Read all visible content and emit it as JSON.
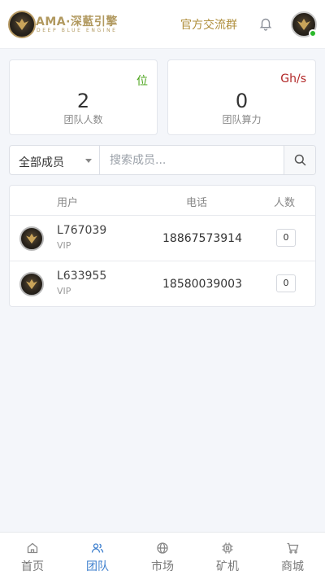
{
  "header": {
    "logo": {
      "title": "AMA·深藍引擎",
      "subtitle": "DEEP BLUE ENGINE"
    },
    "official_link": "官方交流群",
    "status": "online",
    "colors": {
      "accent_gold": "#b08f3c",
      "online": "#2bb82b"
    }
  },
  "stats": [
    {
      "value": "2",
      "unit": "位",
      "label": "团队人数",
      "unit_color": "#49a318"
    },
    {
      "value": "0",
      "unit": "Gh/s",
      "label": "团队算力",
      "unit_color": "#b22727"
    }
  ],
  "filter": {
    "selected": "全部成员",
    "search_placeholder": "搜索成员...",
    "search_icon": "search-icon"
  },
  "table": {
    "headers": {
      "user": "用户",
      "phone": "电话",
      "count": "人数"
    },
    "rows": [
      {
        "user": "L767039",
        "level": "VIP",
        "phone": "18867573914",
        "count": "0"
      },
      {
        "user": "L633955",
        "level": "VIP",
        "phone": "18580039003",
        "count": "0"
      }
    ]
  },
  "nav": {
    "active": "team",
    "active_color": "#3d7fce",
    "items": [
      {
        "label": "首页",
        "icon": "home-icon"
      },
      {
        "label": "团队",
        "icon": "users-icon"
      },
      {
        "label": "市场",
        "icon": "globe-icon"
      },
      {
        "label": "矿机",
        "icon": "chip-icon"
      },
      {
        "label": "商城",
        "icon": "cart-icon"
      }
    ]
  }
}
